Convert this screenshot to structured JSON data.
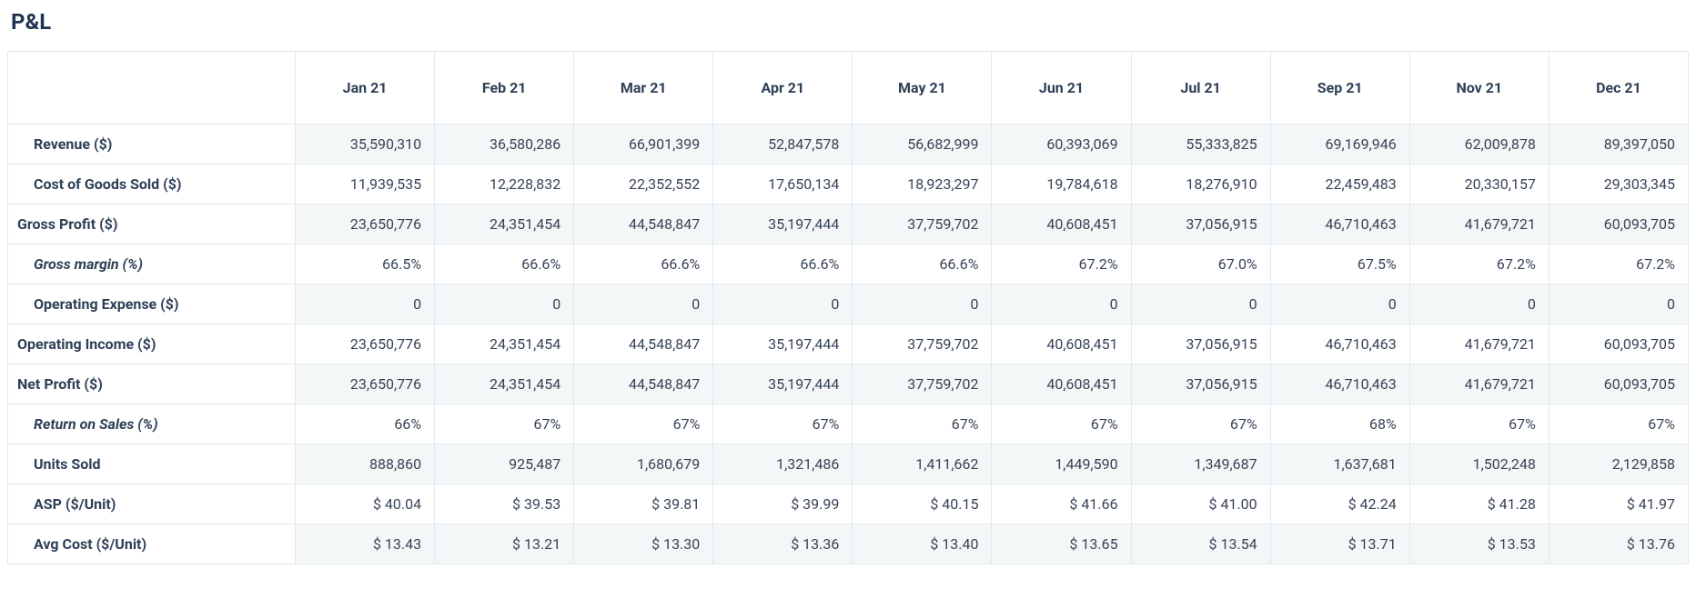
{
  "title": "P&L",
  "columns": [
    "Jan 21",
    "Feb 21",
    "Mar 21",
    "Apr 21",
    "May 21",
    "Jun 21",
    "Jul 21",
    "Sep 21",
    "Nov 21",
    "Dec 21"
  ],
  "rows": [
    {
      "label": "Revenue ($)",
      "indent": 1,
      "italic": false,
      "values": [
        "35,590,310",
        "36,580,286",
        "66,901,399",
        "52,847,578",
        "56,682,999",
        "60,393,069",
        "55,333,825",
        "69,169,946",
        "62,009,878",
        "89,397,050"
      ]
    },
    {
      "label": "Cost of Goods Sold ($)",
      "indent": 1,
      "italic": false,
      "values": [
        "11,939,535",
        "12,228,832",
        "22,352,552",
        "17,650,134",
        "18,923,297",
        "19,784,618",
        "18,276,910",
        "22,459,483",
        "20,330,157",
        "29,303,345"
      ]
    },
    {
      "label": "Gross Profit ($)",
      "indent": 0,
      "italic": false,
      "values": [
        "23,650,776",
        "24,351,454",
        "44,548,847",
        "35,197,444",
        "37,759,702",
        "40,608,451",
        "37,056,915",
        "46,710,463",
        "41,679,721",
        "60,093,705"
      ]
    },
    {
      "label": "Gross margin (%)",
      "indent": 2,
      "italic": true,
      "values": [
        "66.5%",
        "66.6%",
        "66.6%",
        "66.6%",
        "66.6%",
        "67.2%",
        "67.0%",
        "67.5%",
        "67.2%",
        "67.2%"
      ]
    },
    {
      "label": "Operating Expense ($)",
      "indent": 1,
      "italic": false,
      "values": [
        "0",
        "0",
        "0",
        "0",
        "0",
        "0",
        "0",
        "0",
        "0",
        "0"
      ]
    },
    {
      "label": "Operating Income ($)",
      "indent": 0,
      "italic": false,
      "values": [
        "23,650,776",
        "24,351,454",
        "44,548,847",
        "35,197,444",
        "37,759,702",
        "40,608,451",
        "37,056,915",
        "46,710,463",
        "41,679,721",
        "60,093,705"
      ]
    },
    {
      "label": "Net Profit ($)",
      "indent": 0,
      "italic": false,
      "values": [
        "23,650,776",
        "24,351,454",
        "44,548,847",
        "35,197,444",
        "37,759,702",
        "40,608,451",
        "37,056,915",
        "46,710,463",
        "41,679,721",
        "60,093,705"
      ]
    },
    {
      "label": "Return on Sales (%)",
      "indent": 2,
      "italic": true,
      "values": [
        "66%",
        "67%",
        "67%",
        "67%",
        "67%",
        "67%",
        "67%",
        "68%",
        "67%",
        "67%"
      ]
    },
    {
      "label": "Units Sold",
      "indent": 1,
      "italic": false,
      "values": [
        "888,860",
        "925,487",
        "1,680,679",
        "1,321,486",
        "1,411,662",
        "1,449,590",
        "1,349,687",
        "1,637,681",
        "1,502,248",
        "2,129,858"
      ]
    },
    {
      "label": "ASP ($/Unit)",
      "indent": 1,
      "italic": false,
      "values": [
        "$ 40.04",
        "$ 39.53",
        "$ 39.81",
        "$ 39.99",
        "$ 40.15",
        "$ 41.66",
        "$ 41.00",
        "$ 42.24",
        "$ 41.28",
        "$ 41.97"
      ]
    },
    {
      "label": "Avg Cost ($/Unit)",
      "indent": 1,
      "italic": false,
      "values": [
        "$ 13.43",
        "$ 13.21",
        "$ 13.30",
        "$ 13.36",
        "$ 13.40",
        "$ 13.65",
        "$ 13.54",
        "$ 13.71",
        "$ 13.53",
        "$ 13.76"
      ]
    }
  ],
  "chart_data": {
    "type": "table",
    "title": "P&L",
    "columns": [
      "Jan 21",
      "Feb 21",
      "Mar 21",
      "Apr 21",
      "May 21",
      "Jun 21",
      "Jul 21",
      "Sep 21",
      "Nov 21",
      "Dec 21"
    ],
    "series": [
      {
        "name": "Revenue ($)",
        "values": [
          35590310,
          36580286,
          66901399,
          52847578,
          56682999,
          60393069,
          55333825,
          69169946,
          62009878,
          89397050
        ]
      },
      {
        "name": "Cost of Goods Sold ($)",
        "values": [
          11939535,
          12228832,
          22352552,
          17650134,
          18923297,
          19784618,
          18276910,
          22459483,
          20330157,
          29303345
        ]
      },
      {
        "name": "Gross Profit ($)",
        "values": [
          23650776,
          24351454,
          44548847,
          35197444,
          37759702,
          40608451,
          37056915,
          46710463,
          41679721,
          60093705
        ]
      },
      {
        "name": "Gross margin (%)",
        "values": [
          66.5,
          66.6,
          66.6,
          66.6,
          66.6,
          67.2,
          67.0,
          67.5,
          67.2,
          67.2
        ]
      },
      {
        "name": "Operating Expense ($)",
        "values": [
          0,
          0,
          0,
          0,
          0,
          0,
          0,
          0,
          0,
          0
        ]
      },
      {
        "name": "Operating Income ($)",
        "values": [
          23650776,
          24351454,
          44548847,
          35197444,
          37759702,
          40608451,
          37056915,
          46710463,
          41679721,
          60093705
        ]
      },
      {
        "name": "Net Profit ($)",
        "values": [
          23650776,
          24351454,
          44548847,
          35197444,
          37759702,
          40608451,
          37056915,
          46710463,
          41679721,
          60093705
        ]
      },
      {
        "name": "Return on Sales (%)",
        "values": [
          66,
          67,
          67,
          67,
          67,
          67,
          67,
          68,
          67,
          67
        ]
      },
      {
        "name": "Units Sold",
        "values": [
          888860,
          925487,
          1680679,
          1321486,
          1411662,
          1449590,
          1349687,
          1637681,
          1502248,
          2129858
        ]
      },
      {
        "name": "ASP ($/Unit)",
        "values": [
          40.04,
          39.53,
          39.81,
          39.99,
          40.15,
          41.66,
          41.0,
          42.24,
          41.28,
          41.97
        ]
      },
      {
        "name": "Avg Cost ($/Unit)",
        "values": [
          13.43,
          13.21,
          13.3,
          13.36,
          13.4,
          13.65,
          13.54,
          13.71,
          13.53,
          13.76
        ]
      }
    ]
  }
}
